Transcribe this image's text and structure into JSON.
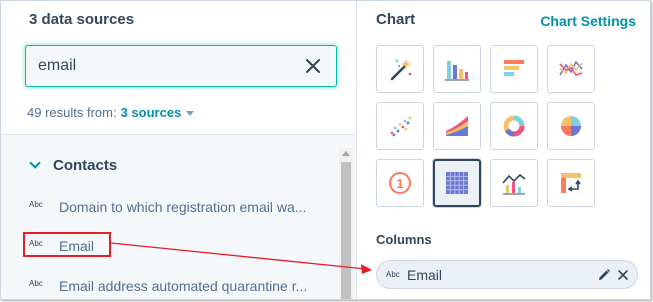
{
  "left_panel": {
    "title": "3 data sources",
    "search": {
      "value": "email",
      "clear_icon": "close-icon"
    },
    "results": {
      "prefix": "49 results from:",
      "link": "3 sources"
    },
    "group": {
      "label": "Contacts"
    },
    "items": [
      {
        "type_badge": "Abc",
        "label": "Domain to which registration email wa..."
      },
      {
        "type_badge": "Abc",
        "label": "Email"
      },
      {
        "type_badge": "Abc",
        "label": "Email address automated quarantine r..."
      }
    ]
  },
  "right_panel": {
    "title": "Chart",
    "settings_link": "Chart Settings",
    "chart_types": [
      {
        "name": "magic-wand-icon"
      },
      {
        "name": "bar-chart-icon"
      },
      {
        "name": "horizontal-bar-icon"
      },
      {
        "name": "line-chart-icon"
      },
      {
        "name": "scatter-icon"
      },
      {
        "name": "area-chart-icon"
      },
      {
        "name": "donut-icon"
      },
      {
        "name": "pie-icon"
      },
      {
        "name": "summary-number-icon"
      },
      {
        "name": "table-icon"
      },
      {
        "name": "combo-chart-icon"
      },
      {
        "name": "pivot-table-icon"
      }
    ],
    "selected_chart": "table-icon",
    "summary_number_text": "1",
    "columns_label": "Columns",
    "column_pill": {
      "type_badge": "Abc",
      "label": "Email"
    }
  },
  "colors": {
    "accent": "#0091ae",
    "focus": "#00bda5",
    "annotation": "#e31e24"
  }
}
